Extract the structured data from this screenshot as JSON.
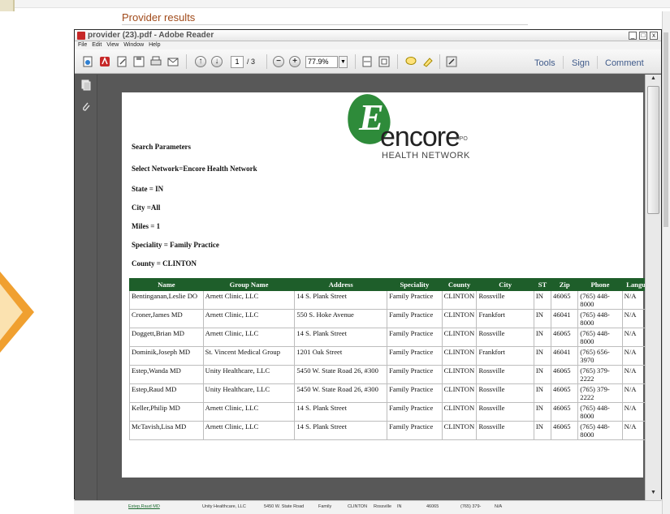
{
  "background_page": {
    "title": "Provider results"
  },
  "window": {
    "title": "provider (23).pdf - Adobe Reader",
    "menus": [
      "File",
      "Edit",
      "View",
      "Window",
      "Help"
    ],
    "controls": {
      "minimize": "_",
      "maximize": "□",
      "close": "x"
    }
  },
  "toolbar": {
    "page_current": "1",
    "page_total": "/ 3",
    "zoom_minus": "−",
    "zoom_plus": "+",
    "zoom_value": "77.9%",
    "links": [
      "Tools",
      "Sign",
      "Comment"
    ],
    "icons": [
      "create-pdf-icon",
      "acrobat-icon",
      "edit-icon",
      "save-icon",
      "print-icon",
      "email-icon",
      "page-up-icon",
      "page-down-icon",
      "zoom-out-icon",
      "zoom-in-icon",
      "fit-width-icon",
      "fit-page-icon",
      "comment-icon",
      "highlight-icon",
      "fullscreen-icon"
    ]
  },
  "sidebar": {
    "icons": [
      "pages-icon",
      "attachments-icon"
    ]
  },
  "logo": {
    "letter": "E",
    "name": "encore",
    "ppo": "PPO",
    "subtitle": "HEALTH NETWORK"
  },
  "params": {
    "heading": "Search Parameters",
    "network": "Select Network=Encore Health Network",
    "state": "State = IN",
    "city": "City =All",
    "miles": "Miles = 1",
    "speciality": "Speciality = Family Practice",
    "county": "County = CLINTON"
  },
  "table": {
    "headers": [
      "Name",
      "Group Name",
      "Address",
      "Speciality",
      "County",
      "City",
      "ST",
      "Zip",
      "Phone",
      "Language"
    ],
    "rows": [
      [
        "Bentinganan,Leslie DO",
        "Arnett Clinic, LLC",
        "14 S. Plank Street",
        "Family Practice",
        "CLINTON",
        "Rossville",
        "IN",
        "46065",
        "(765) 448-8000",
        "N/A"
      ],
      [
        "Croner,James MD",
        "Arnett Clinic, LLC",
        "550 S. Hoke Avenue",
        "Family Practice",
        "CLINTON",
        "Frankfort",
        "IN",
        "46041",
        "(765) 448-8000",
        "N/A"
      ],
      [
        "Doggett,Brian MD",
        "Arnett Clinic, LLC",
        "14 S. Plank Street",
        "Family Practice",
        "CLINTON",
        "Rossville",
        "IN",
        "46065",
        "(765) 448-8000",
        "N/A"
      ],
      [
        "Dominik,Joseph MD",
        "St. Vincent Medical Group",
        "1201 Oak Street",
        "Family Practice",
        "CLINTON",
        "Frankfort",
        "IN",
        "46041",
        "(765) 656-3970",
        "N/A"
      ],
      [
        "Estep,Wanda MD",
        "Unity Healthcare, LLC",
        "5450 W. State Road 26, #300",
        "Family Practice",
        "CLINTON",
        "Rossville",
        "IN",
        "46065",
        "(765) 379-2222",
        "N/A"
      ],
      [
        "Estep,Raud MD",
        "Unity Healthcare, LLC",
        "5450 W. State Road 26, #300",
        "Family Practice",
        "CLINTON",
        "Rossville",
        "IN",
        "46065",
        "(765) 379-2222",
        "N/A"
      ],
      [
        "Keller,Philip MD",
        "Arnett Clinic, LLC",
        "14 S. Plank Street",
        "Family Practice",
        "CLINTON",
        "Rossville",
        "IN",
        "46065",
        "(765) 448-8000",
        "N/A"
      ],
      [
        "McTavish,Lisa MD",
        "Arnett Clinic, LLC",
        "14 S. Plank Street",
        "Family Practice",
        "CLINTON",
        "Rossville",
        "IN",
        "46065",
        "(765) 448-8000",
        "N/A"
      ]
    ]
  },
  "taskbar": {
    "cells": [
      "Estep,Raud MD",
      "Unity Healthcare, LLC",
      "5450 W. State Road",
      "Family",
      "CLINTON",
      "Rossville",
      "IN",
      "46065",
      "(765) 379-",
      "N/A"
    ]
  },
  "colors": {
    "table_header_bg": "#1e5e2a",
    "logo_green": "#2e8b3a",
    "title_brown": "#a04a1a",
    "toolbar_link": "#3f5a8a"
  }
}
